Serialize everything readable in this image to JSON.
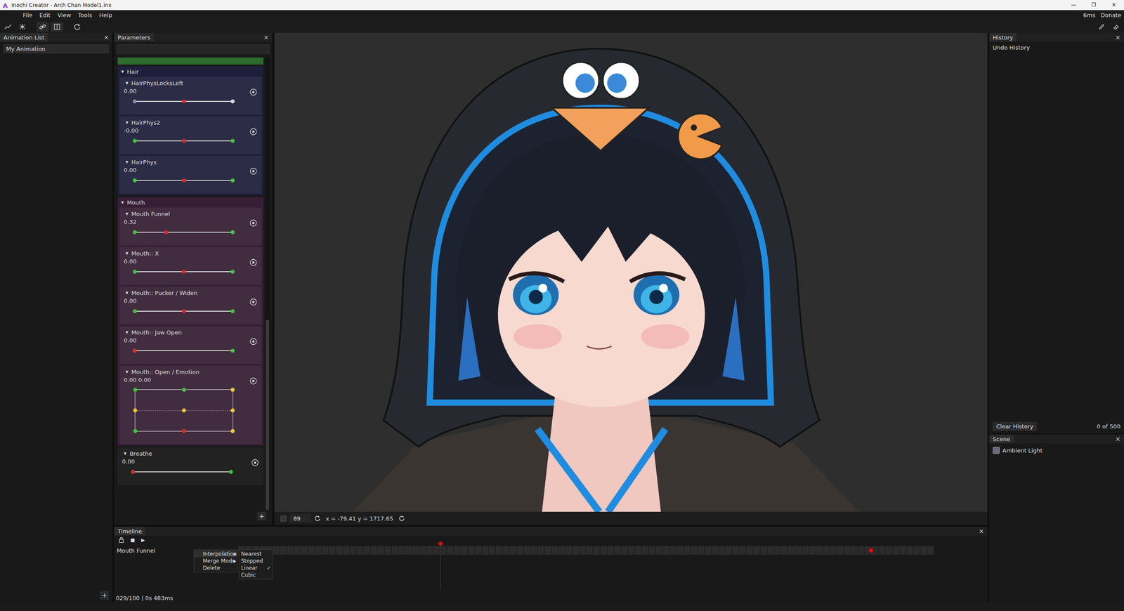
{
  "window": {
    "title": "Inochi Creator - Arch Chan Model1.inx",
    "controls": [
      "—",
      "❐",
      "✕"
    ]
  },
  "menu": [
    "File",
    "Edit",
    "View",
    "Tools",
    "Help"
  ],
  "menu_right": [
    "6ms",
    "Donate"
  ],
  "animation_list": {
    "title": "Animation List",
    "close": "×",
    "items": [
      {
        "label": "My Animation",
        "selected": true
      }
    ],
    "add": "+"
  },
  "parameters": {
    "title": "Parameters",
    "close": "×",
    "search": {
      "value": ""
    },
    "scroll_level": 1,
    "items": [
      {
        "kind": "cut",
        "color": "#2e6b30"
      },
      {
        "kind": "group",
        "name": "Hair",
        "toggle": "▼",
        "expanded": true,
        "color": "#1f1f3b",
        "params": [
          {
            "kind": "slider",
            "name": "HairPhysLocksLeft",
            "toggle": "▼",
            "value": "0.00",
            "level": 0.5,
            "keys": [
              "#8a8aa2",
              "#d4d4e4"
            ]
          },
          {
            "kind": "slider",
            "name": "HairPhys2",
            "toggle": "▼",
            "value": "-0.00",
            "level": 0.5,
            "keys": [
              "#3ec43e",
              "#3ec43e"
            ]
          },
          {
            "kind": "slider",
            "name": "HairPhys",
            "toggle": "▼",
            "value": "0.00",
            "level": 0.5,
            "keys": [
              "#3ec43e",
              "#3ec43e"
            ]
          }
        ]
      },
      {
        "kind": "group",
        "name": "Mouth",
        "toggle": "▼",
        "expanded": true,
        "color": "#371f35",
        "params": [
          {
            "kind": "slider",
            "name": "Mouth Funnel",
            "toggle": "▼",
            "value": "0.32",
            "level": 0.32,
            "keys": [
              "#3ec43e",
              "#3ec43e"
            ]
          },
          {
            "kind": "slider",
            "name": "Mouth:: X",
            "toggle": "▼",
            "value": "0.00",
            "level": 0.5,
            "keys": [
              "#3ec43e",
              "#3ec43e"
            ]
          },
          {
            "kind": "slider",
            "name": "Mouth:: Pucker / Widen",
            "toggle": "▼",
            "value": "0.00",
            "level": 0.5,
            "keys": [
              "#3ec43e",
              "#3ec43e"
            ]
          },
          {
            "kind": "slider",
            "name": "Mouth:: Jaw Open",
            "toggle": "▼",
            "value": "0.00",
            "level": 0,
            "keys": [
              "#3ec43e",
              "#3ec43e"
            ]
          },
          {
            "kind": "grid2d",
            "name": "Mouth:: Open / Emotion",
            "toggle": "▼",
            "value": "0.00 0.00",
            "level_x": 0.5,
            "level_y": 0,
            "keys": [
              [
                "#3ec43e",
                "#3ec43e",
                "#e8c93a"
              ],
              [
                "#e8c93a",
                "#e8c93a",
                "#e8c93a"
              ],
              [
                "#3ec43e",
                "#3ec43e",
                "#e8c93a"
              ]
            ]
          }
        ]
      },
      {
        "kind": "slider",
        "name": "Breathe",
        "toggle": "▼",
        "value": "0.00",
        "level": 0,
        "keys": [
          "#3ec43e",
          "#3ec43e"
        ],
        "color": "#222222"
      }
    ],
    "add": "+"
  },
  "viewport": {
    "checked": false,
    "zoom": "89",
    "coords": "x = -79.41 y = 1717.65"
  },
  "history": {
    "title": "History",
    "close": "×",
    "subtitle": "Undo History",
    "clear": "Clear History",
    "count": "0 of 500"
  },
  "scene": {
    "title": "Scene",
    "close": "×",
    "items": [
      {
        "label": "Ambient Light",
        "checked": false
      }
    ]
  },
  "timeline": {
    "title": "Timeline",
    "close": "×",
    "stop": "■",
    "play": "▶",
    "frame_count": 100,
    "playhead": 0.29,
    "tracks": [
      {
        "name": "Mouth Funnel",
        "dropdown": "⌄",
        "keyframes": [
          0.909
        ]
      }
    ],
    "status": "029/100 | 0s 483ms",
    "context_menu": [
      {
        "label": "Interpolation",
        "arrow": "▶",
        "selected": true
      },
      {
        "label": "Merge Mode",
        "arrow": "▶",
        "selected": false
      },
      {
        "label": "Delete",
        "arrow": "",
        "selected": false
      }
    ],
    "submenu": [
      {
        "label": "Nearest",
        "checked": false,
        "mark": "✓"
      },
      {
        "label": "Stepped",
        "checked": false,
        "mark": "✓"
      },
      {
        "label": "Linear",
        "checked": true,
        "mark": "✓"
      },
      {
        "label": "Cubic",
        "checked": false,
        "mark": "✓"
      }
    ]
  }
}
